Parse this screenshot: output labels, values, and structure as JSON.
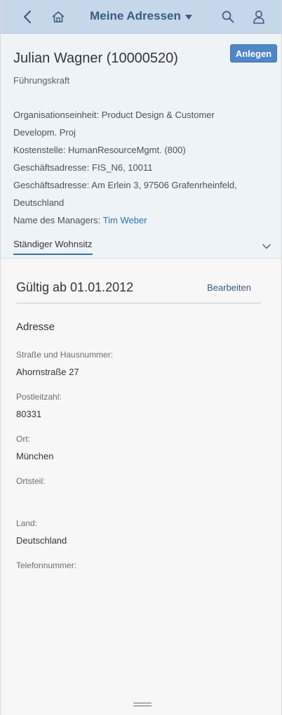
{
  "shellbar": {
    "title": "Meine Adressen",
    "icons": {
      "back": "back-arrow-icon",
      "home": "home-icon",
      "search": "search-icon",
      "user": "user-icon"
    }
  },
  "header": {
    "name": "Julian Wagner (10000520)",
    "create_label": "Anlegen",
    "role": "Führungskraft",
    "org_unit": "Organisationseinheit: Product Design & Customer",
    "org_unit_cont": "Developm. Proj",
    "cost_center": "Kostenstelle: HumanResourceMgmt. (800)",
    "business_address_1": "Geschäftsadresse: FIS_N6, 10011",
    "business_address_2": "Geschäftsadresse: Am Erlein 3, 97506 Grafenrheinfeld,",
    "business_address_2_cont": "Deutschland",
    "manager_label": "Name des Managers:",
    "manager_name": "Tim Weber",
    "tab_label": "Ständiger Wohnsitz"
  },
  "content": {
    "valid_from": "Gültig ab 01.01.2012",
    "edit_label": "Bearbeiten",
    "section_title": "Adresse",
    "fields": [
      {
        "label": "Straße und Hausnummer:",
        "value": "Ahornstraße 27"
      },
      {
        "label": "Postleitzahl:",
        "value": "80331"
      },
      {
        "label": "Ort:",
        "value": "München"
      },
      {
        "label": "Ortsteil:",
        "value": ""
      },
      {
        "label": "Land:",
        "value": "Deutschland"
      },
      {
        "label": "Telefonnummer:",
        "value": ""
      }
    ]
  },
  "colors": {
    "shellbar": "#c6d7ea",
    "header_bg": "#eef3f8",
    "accent": "#4f86c6",
    "link": "#2a73b6"
  }
}
